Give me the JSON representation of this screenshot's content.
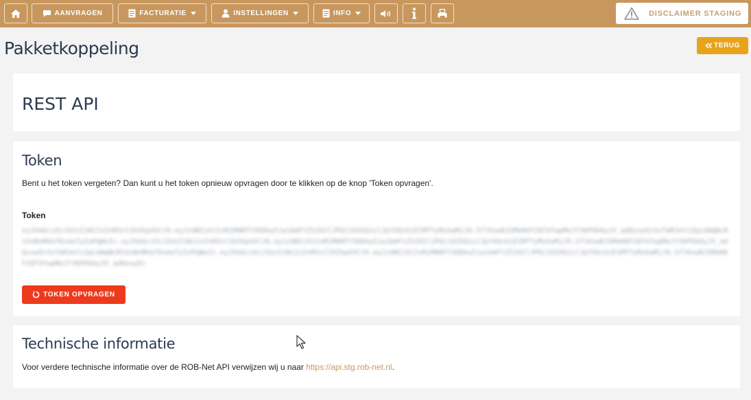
{
  "navbar": {
    "home_icon": "home-icon",
    "aanvragen": "AANVRAGEN",
    "facturatie": "FACTURATIE",
    "instellingen": "INSTELLINGEN",
    "info": "INFO",
    "sound_icon": "volume-icon",
    "info_icon": "info-icon",
    "print_icon": "printer-icon",
    "disclaimer": "DISCLAIMER STAGING"
  },
  "page": {
    "title": "Pakketkoppeling",
    "back_label": "TERUG"
  },
  "rest_api": {
    "heading": "REST API"
  },
  "token_section": {
    "heading": "Token",
    "description": "Bent u het token vergeten? Dan kunt u het token opnieuw opvragen door te klikken op de knop 'Token opvragen'.",
    "label": "Token",
    "value": "eyJhbGciOiJIUzI1NiIsInR5cCI6IkpXVCJ9.eyJzdWIiOiIxMjM0NTY3ODkwIiwibmFtZSI6IlJPQi1OZXQiLCJpYXQiOjE1MTYyMzkwMjJ9.SflKxwRJSMeKKF2QT4fwpMeJf36POk6yJV_adQssw5cVxTmR3eYzZpLkWqNcRtUvBnMhGfDsAeTyIoPqWxZc.eyJhbGciOiJIUzI1NiIsInR5cCI6IkpXVCJ9.eyJzdWIiOiIxMjM0NTY3ODkwIiwibmFtZSI6IlJPQi1OZXQiLCJpYXQiOjE1MTYyMzkwMjJ9.SflKxwRJSMeKKF2QT4fwpMeJf36POk6yJV_adQssw5cVxTmR3eYzZpLkWqNcRtUvBnMhGfDsAeTyIoPqWxZc.eyJhbGciOiJIUzI1NiIsInR5cCI6IkpXVCJ9.eyJzdWIiOiIxMjM0NTY3ODkwIiwibmFtZSI6IlJPQi1OZXQiLCJpYXQiOjE1MTYyMzkwMjJ9.SflKxwRJSMeKKF2QT4fwpMeJf36POk6yJV_adQssw5c",
    "button": "TOKEN OPVRAGEN"
  },
  "technical": {
    "heading": "Technische informatie",
    "text": "Voor verdere technische informatie over de ROB-Net API verwijzen wij u naar ",
    "link": "https://api.stg.rob-net.nl",
    "suffix": "."
  },
  "colors": {
    "navbar": "#c8975e",
    "back_button": "#e8a31a",
    "token_button": "#ee3a1c",
    "heading": "#2b3a4f"
  }
}
